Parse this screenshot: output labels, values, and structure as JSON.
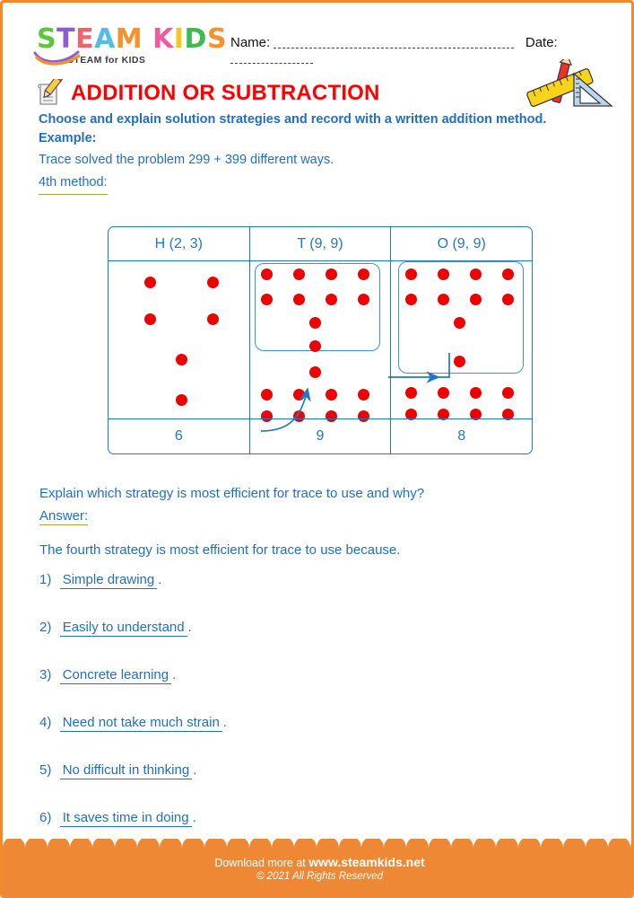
{
  "brand": {
    "logo_letters": [
      {
        "ch": "S",
        "color": "#5cc63c"
      },
      {
        "ch": "T",
        "color": "#8b5cd6"
      },
      {
        "ch": "E",
        "color": "#f1636a"
      },
      {
        "ch": "A",
        "color": "#53bdea"
      },
      {
        "ch": "M",
        "color": "#f5922c"
      },
      {
        "ch": " ",
        "color": "#ffffff"
      },
      {
        "ch": "K",
        "color": "#ef5ba1"
      },
      {
        "ch": "I",
        "color": "#f5c521"
      },
      {
        "ch": "D",
        "color": "#3dbb4e"
      },
      {
        "ch": "S",
        "color": "#f5922c"
      }
    ],
    "tagline": "STEAM for KIDS",
    "accent_orange": "#ef8834",
    "accent_blue": "#1f6fc4",
    "accent_red": "#ff0000",
    "dot_red": "#ee0000"
  },
  "header": {
    "name_label": "Name:",
    "date_label": "Date:"
  },
  "title": {
    "text": "ADDITION OR SUBTRACTION",
    "icon": "pencil-paper-icon"
  },
  "intro": {
    "instruction": "Choose and explain solution strategies and record with a written addition method.",
    "example_label": "Example:",
    "problem": "Trace solved the problem 299 + 399 different ways.",
    "method_label": "4th method:"
  },
  "table": {
    "headers": [
      "H (2, 3)",
      "T (9, 9)",
      "O (9, 9)"
    ],
    "totals": [
      "6",
      "9",
      "8"
    ],
    "columns": [
      {
        "name": "hundreds",
        "grouped_dots": 0,
        "loose_dots": 6,
        "has_group_box": false
      },
      {
        "name": "tens",
        "grouped_dots": 10,
        "loose_dots": 9,
        "has_group_box": true
      },
      {
        "name": "ones",
        "grouped_dots": 10,
        "loose_dots": 8,
        "has_group_box": true
      }
    ],
    "arrows": [
      {
        "name": "tens-to-hundreds-carry-arrow"
      },
      {
        "name": "ones-to-tens-carry-arrow"
      }
    ]
  },
  "qa": {
    "question": "Explain which strategy is most efficient for trace to use and why?",
    "answer_label": "Answer:",
    "answer_intro": "The fourth strategy is most efficient for trace to use because.",
    "items": [
      {
        "num": "1)",
        "value": "Simple drawing",
        "end": "."
      },
      {
        "num": "2)",
        "value": "Easily to understand",
        "end": "."
      },
      {
        "num": "3)",
        "value": "Concrete learning",
        "end": "."
      },
      {
        "num": "4)",
        "value": "Need not take much strain",
        "end": "."
      },
      {
        "num": "5)",
        "value": "No difficult in thinking",
        "end": "."
      },
      {
        "num": "6)",
        "value": "It saves time in doing",
        "end": "."
      }
    ]
  },
  "footer": {
    "download_prefix": "Download more at",
    "site": "www.steamkids.net",
    "copyright": "© 2021 All Rights Reserved"
  }
}
